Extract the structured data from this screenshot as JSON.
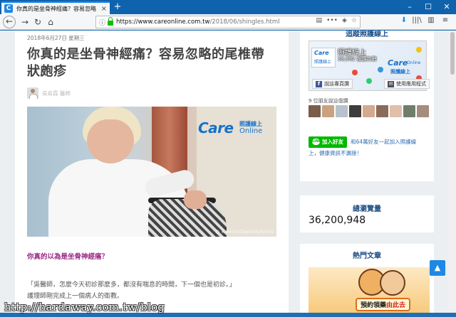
{
  "browser": {
    "tab_title": "你真的是坐骨神經痛？容易忽略",
    "tab_close": "×",
    "new_tab": "+",
    "favicon_letter": "C",
    "url_host": "https://www.careonline.com.tw",
    "url_path": "/2018/06/shingles.html",
    "win_min": "–",
    "win_max": "☐",
    "win_close": "✕"
  },
  "article": {
    "meta": "2018年6月27日 星期三",
    "title": "你真的是坐骨神經痛？容易忽略的尾椎帶狀皰疹",
    "author": "吳奇霖 醫師",
    "hero_brand_care": "Care",
    "hero_brand_zh": "照護線上",
    "hero_brand_online": "Online",
    "hero_credit": "© Kzenon/Depositphotos",
    "subheading": "你真的以為是坐骨神經痛？",
    "para1": "「吳醫師，怎麼今天初診那麼多，都沒有喘息的時間，下一個也是初診。」",
    "para2": "護理師剛完成上一個病人的衛教。"
  },
  "sidebar": {
    "follow_title": "追蹤照護線上",
    "fb_page_name": "照護線上",
    "fb_page_count": "38,982 按讚次數",
    "fb_logo_care": "Care",
    "fb_logo_zh": "照護線上",
    "fb_big_care": "Care",
    "fb_big_online": "Online",
    "fb_big_zh": "照護線上",
    "fb_like_btn": "說這專頁讚",
    "fb_app_btn": "使用應用程式",
    "friends_text": "9 位朋友說這個讚",
    "line_btn": "加入好友",
    "line_text1": "和64萬好友一起加入照護線",
    "line_text2": "上，健康資訊不漏接！",
    "views_title": "總瀏覽量",
    "views_count": "36,200,948",
    "hot_title": "熱門文章",
    "banner_text": "預約領藥",
    "banner_highlight": "由此去"
  },
  "watermark": "http://hardaway.com.tw/blog",
  "colors": {
    "brand_blue": "#1672c9",
    "subheading_purple": "#9a2b86",
    "line_green": "#00b900",
    "tab_bar": "#0f63ad"
  }
}
